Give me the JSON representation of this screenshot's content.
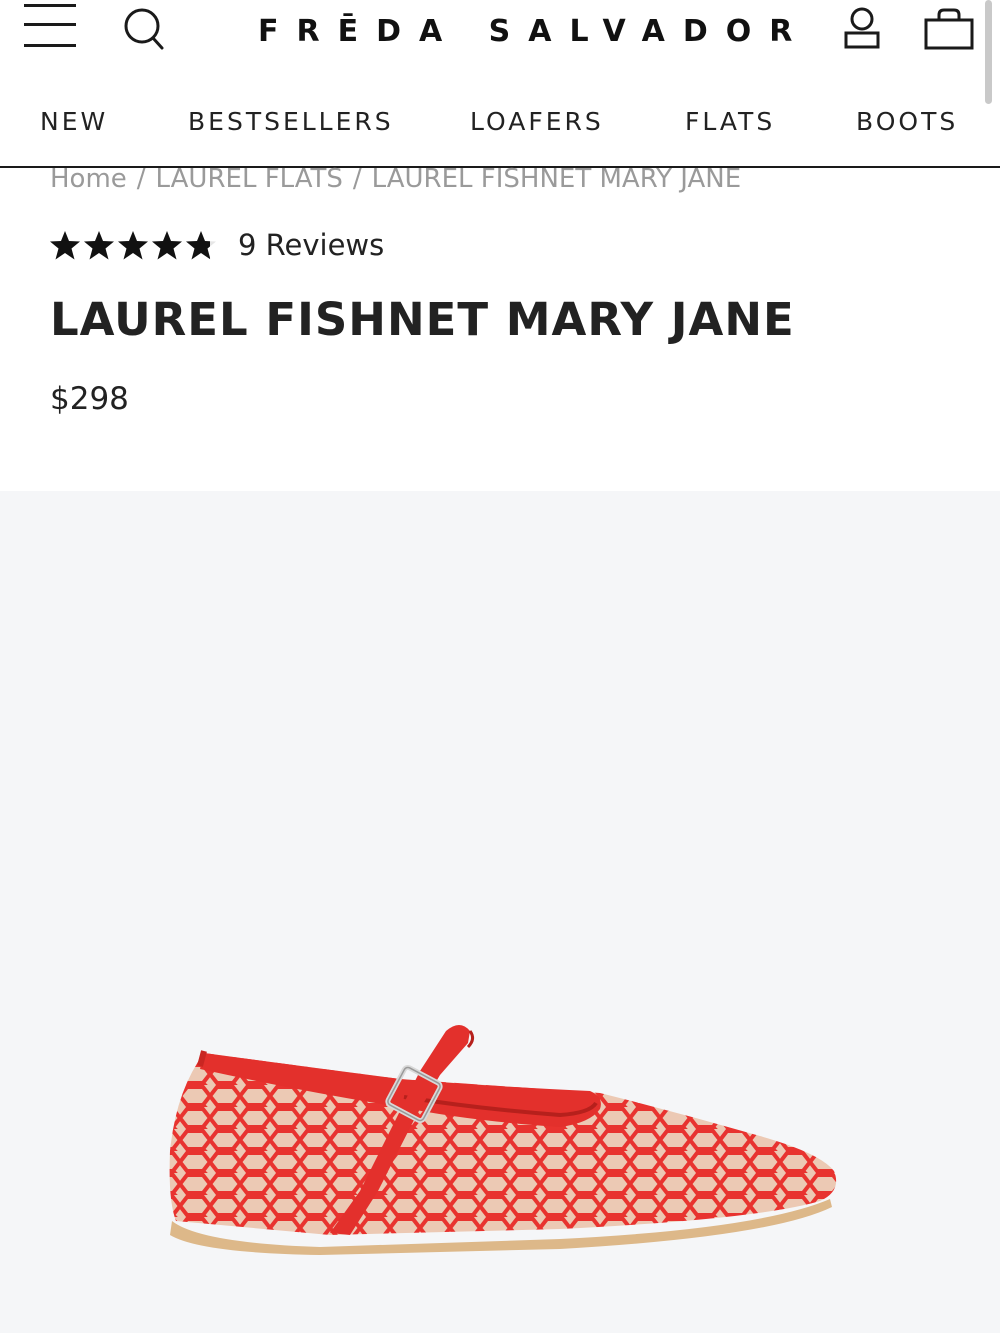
{
  "header": {
    "brand": "FRĒDA SALVADOR",
    "menu_icon": "hamburger-menu-icon",
    "search_icon": "search-icon",
    "account_icon": "user-account-icon",
    "bag_icon": "shopping-bag-icon"
  },
  "nav": {
    "items": [
      {
        "label": "NEW"
      },
      {
        "label": "BESTSELLERS"
      },
      {
        "label": "LOAFERS"
      },
      {
        "label": "FLATS"
      },
      {
        "label": "BOOTS"
      }
    ]
  },
  "breadcrumb": {
    "items": [
      {
        "label": "Home"
      },
      {
        "label": "LAUREL FLATS"
      },
      {
        "label": "LAUREL FISHNET MARY JANE"
      }
    ],
    "separator": "/"
  },
  "product": {
    "rating": 4.8,
    "rating_max": 5,
    "reviews_label": "9 Reviews",
    "title": "LAUREL FISHNET MARY JANE",
    "price": "$298"
  },
  "colors": {
    "accent": "#e8332f",
    "image_background": "#f5f6f8",
    "breadcrumb_text": "#9a9a9a"
  }
}
